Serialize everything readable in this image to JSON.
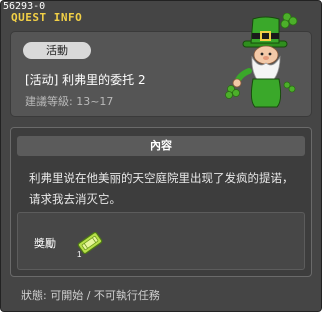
{
  "window": {
    "id_label": "56293-0",
    "title": "QUEST INFO"
  },
  "quest": {
    "category": "活動",
    "name": "[活动] 利弗里的委托 2",
    "level": "建議等級: 13~17"
  },
  "content": {
    "header": "內容",
    "description": "利弗里说在他美丽的天空庭院里出现了发疯的提诺，请求我去消灭它。"
  },
  "reward": {
    "label": "獎勵",
    "item_icon": "green-ticket-icon"
  },
  "status": {
    "text": "狀態: 可開始 / 不可執行任務"
  },
  "colors": {
    "title": "#f2d046",
    "window_bg": "#454545",
    "badge_bg": "#d9d9d9"
  }
}
